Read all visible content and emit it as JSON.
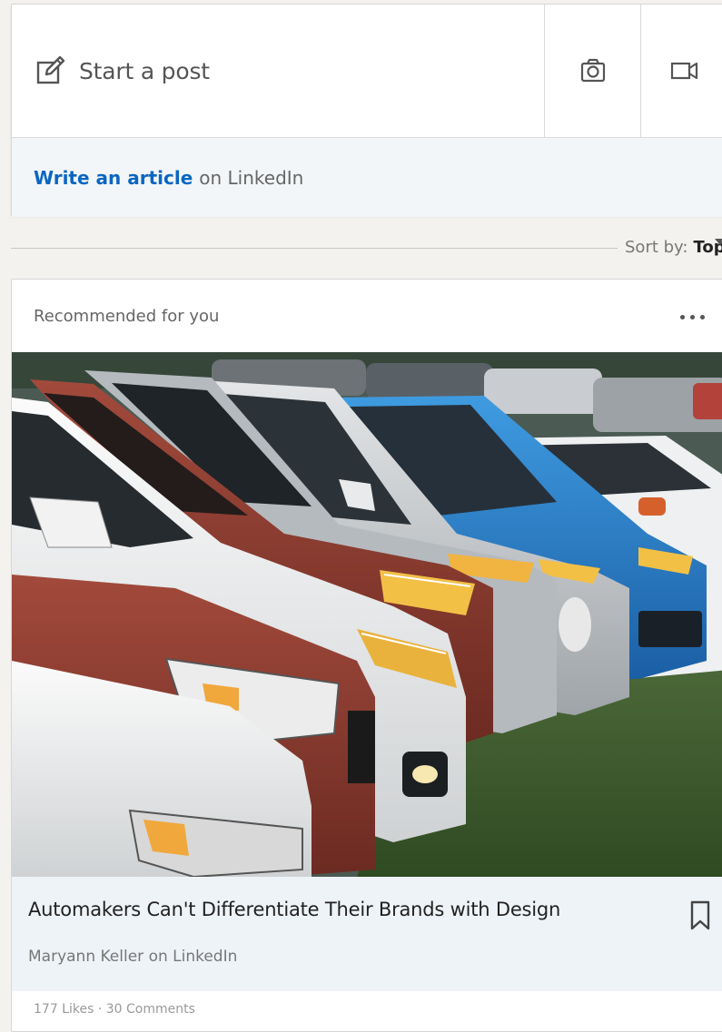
{
  "share_box": {
    "start_post_label": "Start a post",
    "icons": {
      "compose": "pencil-square-icon",
      "photo": "camera-icon",
      "video": "video-camera-icon"
    },
    "write_article_link": "Write an article",
    "write_article_suffix": "on LinkedIn"
  },
  "sort": {
    "label": "Sort by:",
    "value": "Top"
  },
  "feed_card": {
    "header_label": "Recommended for you",
    "more_icon": "ellipsis-icon",
    "article": {
      "title": "Automakers Can't Differentiate Their Brands with Design",
      "source": "Maryann Keller on LinkedIn",
      "bookmark_icon": "bookmark-icon"
    },
    "social_counts": "177 Likes · 30 Comments"
  },
  "colors": {
    "link_blue": "#0a66c2",
    "page_background": "#f3f2ef",
    "meta_background": "#eef3f8"
  }
}
